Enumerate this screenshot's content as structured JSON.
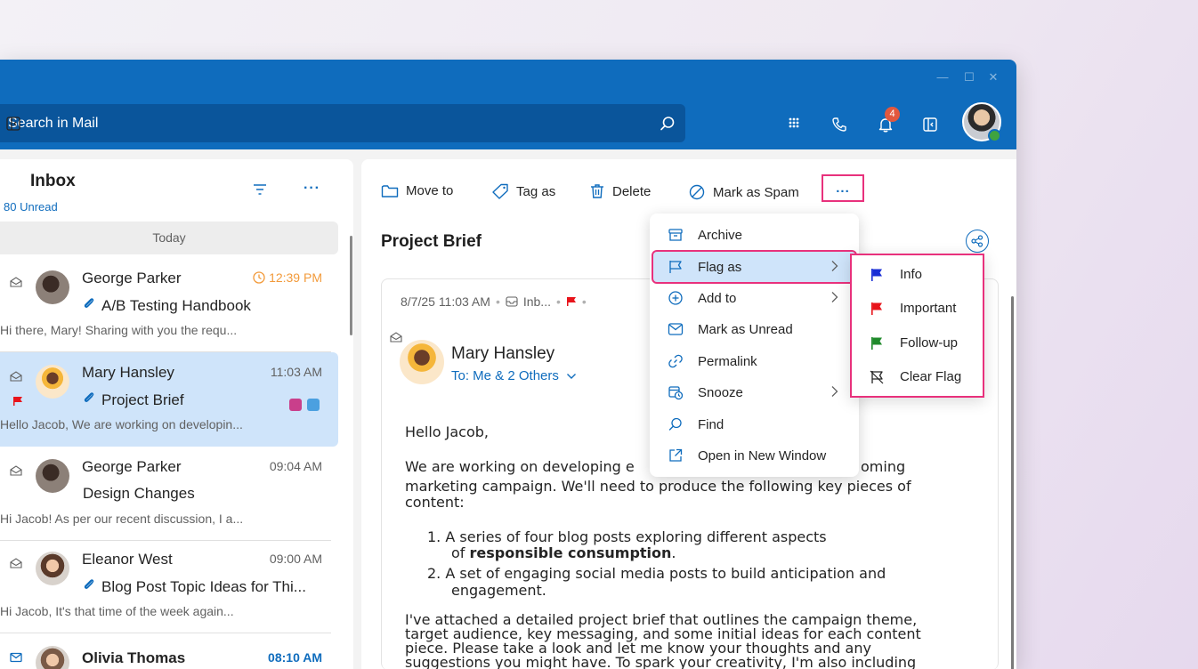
{
  "search": {
    "placeholder": "Search in Mail"
  },
  "header": {
    "notification_count": "4"
  },
  "list": {
    "title": "Inbox",
    "unread_label": "80 Unread",
    "group_label": "Today",
    "items": [
      {
        "sender": "George Parker",
        "time": "12:39 PM",
        "subject": "A/B Testing Handbook",
        "preview": "Hi there, Mary! Sharing with you the requ...",
        "attachment": true
      },
      {
        "sender": "Mary Hansley",
        "time": "11:03 AM",
        "subject": "Project Brief",
        "preview": "Hello Jacob, We are working on developin...",
        "attachment": true,
        "flagged": true
      },
      {
        "sender": "George Parker",
        "time": "09:04 AM",
        "subject": "Design Changes",
        "preview": "Hi Jacob! As per our recent discussion, I a..."
      },
      {
        "sender": "Eleanor West",
        "time": "09:00 AM",
        "subject": "Blog Post Topic Ideas for Thi...",
        "preview": "Hi Jacob, It's that time of the week again...",
        "attachment": true
      },
      {
        "sender": "Olivia Thomas",
        "time": "08:10 AM",
        "unread": true
      }
    ]
  },
  "toolbar": {
    "move_to": "Move to",
    "tag_as": "Tag as",
    "delete": "Delete",
    "mark_spam": "Mark as Spam",
    "more": "..."
  },
  "message": {
    "subject": "Project Brief",
    "datetime": "8/7/25 11:03 AM",
    "folder": "Inb...",
    "from": "Mary Hansley",
    "to": "To: Me & 2 Others",
    "greeting": "Hello Jacob,",
    "para1_line1_a": "We are working on developing e",
    "para1_line1_b": "oming",
    "para1_line2": "marketing campaign. We'll need to produce the following key pieces of",
    "para1_line3": "content:",
    "list1_line1": "1.  A series of four blog posts exploring different aspects",
    "list1_line2_a": "of ",
    "list1_line2_bold": "responsible consumption",
    "list1_line2_end": ".",
    "list2_line1": "2.  A set of engaging social media posts to build anticipation and",
    "list2_line2": "engagement.",
    "para2_line1": "I've attached a detailed project brief that outlines the campaign theme,",
    "para2_line2": "target audience, key messaging, and some initial ideas for each content",
    "para2_line3": "piece. Please take a look and let me know your thoughts and any",
    "para2_line4": "suggestions you might have. To spark your creativity, I'm also including"
  },
  "menu": {
    "items": [
      "Archive",
      "Flag as",
      "Add to",
      "Mark as Unread",
      "Permalink",
      "Snooze",
      "Find",
      "Open in New Window"
    ]
  },
  "flag_submenu": {
    "items": [
      {
        "label": "Info",
        "color": "#1a2fd6"
      },
      {
        "label": "Important",
        "color": "#e8141b"
      },
      {
        "label": "Follow-up",
        "color": "#1f8a2b"
      },
      {
        "label": "Clear Flag"
      }
    ]
  },
  "colors": {
    "accent": "#0f6cbd",
    "highlight": "#e8317c",
    "selected_row": "#cfe4fa"
  }
}
